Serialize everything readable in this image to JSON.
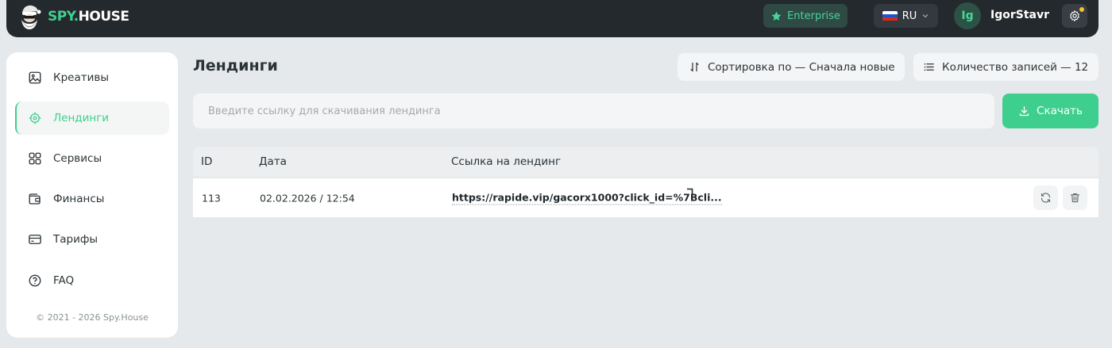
{
  "header": {
    "logo_brand": "SPY",
    "logo_dot": ".",
    "logo_suffix": "HOUSE",
    "plan_label": "Enterprise",
    "language": "RU",
    "avatar_initials": "Ig",
    "username": "IgorStavr",
    "icons": [
      "santa-logo-icon",
      "star-icon",
      "russia-flag-icon",
      "chevron-down-icon",
      "gear-icon"
    ]
  },
  "sidebar": {
    "items": [
      {
        "label": "Креативы",
        "icon": "image-icon",
        "active": false
      },
      {
        "label": "Лендинги",
        "icon": "target-icon",
        "active": true
      },
      {
        "label": "Сервисы",
        "icon": "grid-icon",
        "active": false
      },
      {
        "label": "Финансы",
        "icon": "wallet-icon",
        "active": false
      },
      {
        "label": "Тарифы",
        "icon": "card-icon",
        "active": false
      },
      {
        "label": "FAQ",
        "icon": "help-icon",
        "active": false
      }
    ],
    "copyright": "© 2021 - 2026 Spy.House"
  },
  "main": {
    "title": "Лендинги",
    "sort_label": "Сортировка по — Сначала новые",
    "count_label": "Количество записей — 12",
    "url_input": {
      "placeholder": "Введите ссылку для скачивания лендинга",
      "value": ""
    },
    "download_label": "Скачать",
    "table": {
      "columns": [
        "ID",
        "Дата",
        "Ссылка на лендинг"
      ],
      "rows": [
        {
          "id": "113",
          "date": "02.02.2026 / 12:54",
          "link": "https://rapide.vip/gacorx1000?click_id=%7Bcli..."
        }
      ]
    }
  },
  "colors": {
    "accent": "#3ecf8e",
    "header_bg": "#24292d",
    "page_bg": "#e6e9eb",
    "notification": "#f3c623"
  }
}
